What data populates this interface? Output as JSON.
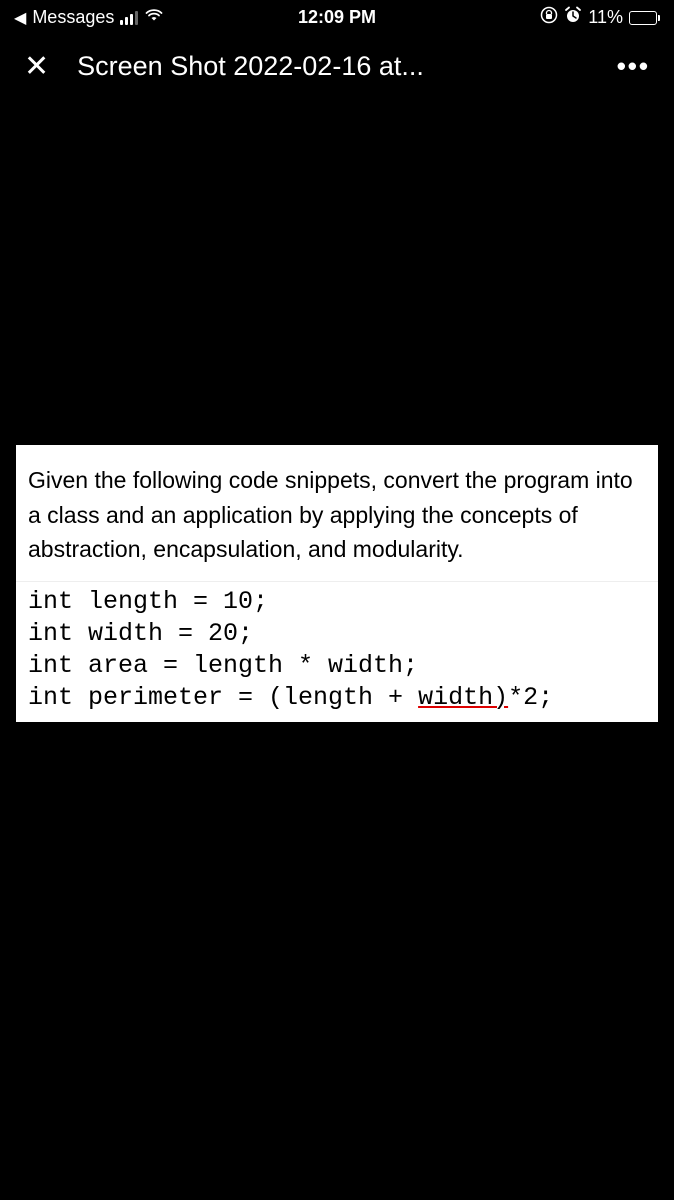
{
  "statusBar": {
    "backApp": "Messages",
    "time": "12:09 PM",
    "batteryPercent": "11%"
  },
  "titleBar": {
    "title": "Screen Shot 2022-02-16 at..."
  },
  "content": {
    "question": "Given the following code snippets, convert the program into a class and an application by applying the concepts of abstraction, encapsulation, and modularity.",
    "code": {
      "line1": "int length = 10;",
      "line2": "int width = 20;",
      "line3": "int area = length * width;",
      "line4_part1": "int perimeter = (length + ",
      "line4_underlined": "width)",
      "line4_part2": "*2;"
    }
  }
}
